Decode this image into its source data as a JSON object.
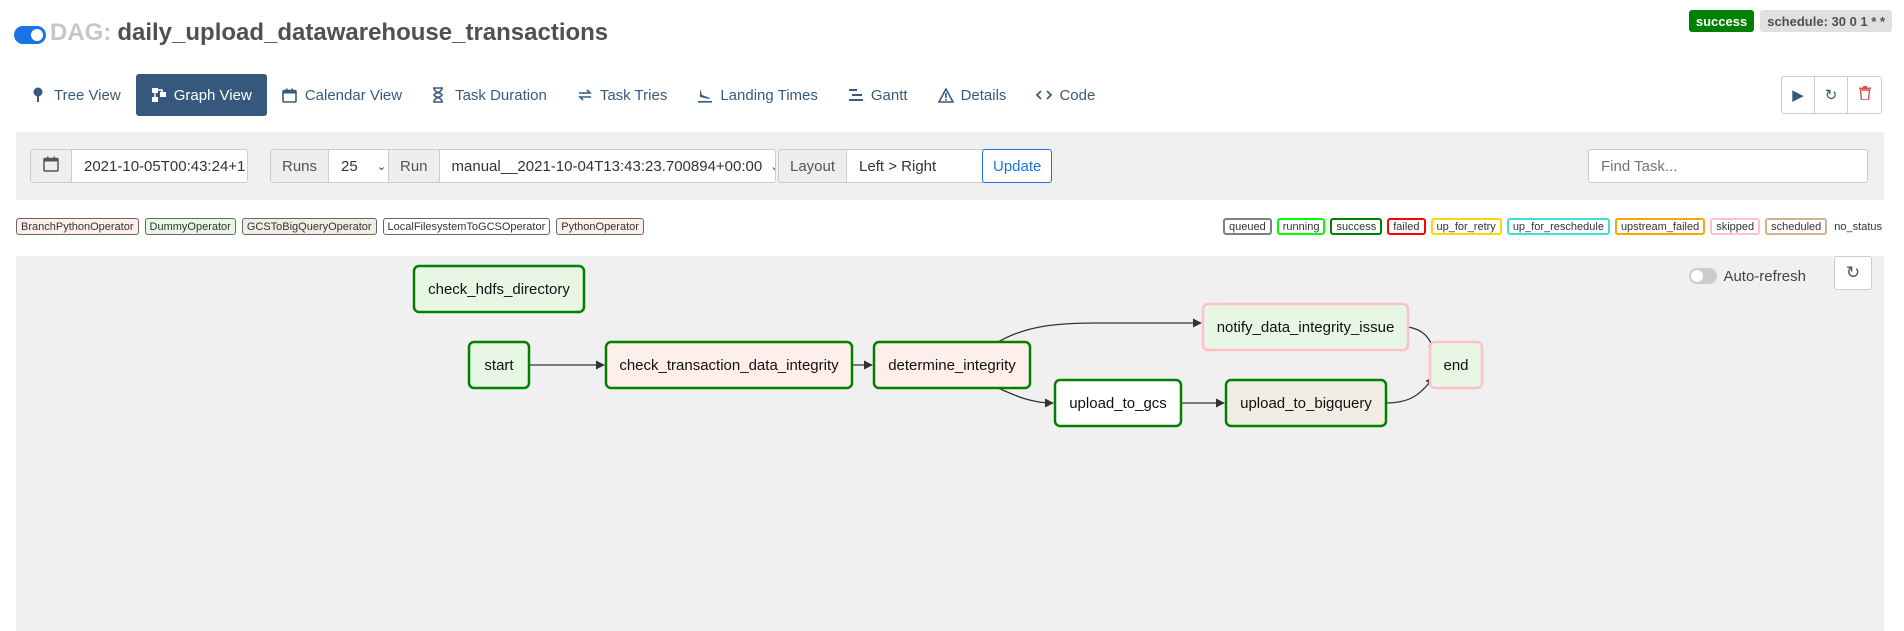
{
  "header": {
    "dag_label": "DAG:",
    "dag_id": "daily_upload_datawarehouse_transactions",
    "toggle_icon": "toggle-on-icon",
    "state_badge": "success",
    "schedule_badge": "schedule: 30 0 1 * *"
  },
  "nav": {
    "tabs": [
      {
        "label": "Tree View",
        "icon": "tree-icon"
      },
      {
        "label": "Graph View",
        "icon": "graph-icon",
        "active": true
      },
      {
        "label": "Calendar View",
        "icon": "calendar-icon"
      },
      {
        "label": "Task Duration",
        "icon": "hourglass-icon"
      },
      {
        "label": "Task Tries",
        "icon": "retry-icon"
      },
      {
        "label": "Landing Times",
        "icon": "plane-landing-icon"
      },
      {
        "label": "Gantt",
        "icon": "gantt-icon"
      },
      {
        "label": "Details",
        "icon": "warning-triangle-icon"
      },
      {
        "label": "Code",
        "icon": "code-icon"
      }
    ],
    "tools": [
      {
        "icon": "play-icon"
      },
      {
        "icon": "refresh-icon"
      },
      {
        "icon": "trash-icon"
      }
    ]
  },
  "filters": {
    "date_icon": "calendar-icon",
    "base_date": "2021-10-05T00:43:24+1",
    "runs_label": "Runs",
    "runs_value": "25",
    "run_label": "Run",
    "run_value": "manual__2021-10-04T13:43:23.700894+00:00",
    "layout_label": "Layout",
    "layout_value": "Left > Right",
    "update_label": "Update",
    "find_placeholder": "Find Task..."
  },
  "legend": {
    "operators": [
      {
        "label": "BranchPythonOperator",
        "color": "#ffefeb"
      },
      {
        "label": "DummyOperator",
        "color": "#e8f7e4"
      },
      {
        "label": "GCSToBigQueryOperator",
        "color": "#f0eee4"
      },
      {
        "label": "LocalFilesystemToGCSOperator",
        "color": "#ffffff"
      },
      {
        "label": "PythonOperator",
        "color": "#ffefeb"
      }
    ],
    "states": [
      {
        "label": "queued",
        "color": "#808080"
      },
      {
        "label": "running",
        "color": "#00ff00"
      },
      {
        "label": "success",
        "color": "#008000"
      },
      {
        "label": "failed",
        "color": "#ff0000"
      },
      {
        "label": "up_for_retry",
        "color": "#ffd700"
      },
      {
        "label": "up_for_reschedule",
        "color": "#40e0d0"
      },
      {
        "label": "upstream_failed",
        "color": "#ffa500"
      },
      {
        "label": "skipped",
        "color": "#ffc0cb"
      },
      {
        "label": "scheduled",
        "color": "#d2b48c"
      },
      {
        "label": "no_status",
        "color": ""
      }
    ]
  },
  "graph": {
    "auto_refresh_label": "Auto-refresh",
    "refresh_icon": "refresh-icon",
    "nodes": [
      {
        "id": "check_hdfs_directory",
        "label": "check_hdfs_directory",
        "state": "success",
        "fill": "#e8f7e4",
        "stroke": "#008000"
      },
      {
        "id": "start",
        "label": "start",
        "state": "success",
        "fill": "#e8f7e4",
        "stroke": "#008000"
      },
      {
        "id": "check_transaction_data_integrity",
        "label": "check_transaction_data_integrity",
        "state": "success",
        "fill": "#ffefeb",
        "stroke": "#008000"
      },
      {
        "id": "determine_integrity",
        "label": "determine_integrity",
        "state": "success",
        "fill": "#ffefeb",
        "stroke": "#008000"
      },
      {
        "id": "notify_data_integrity_issue",
        "label": "notify_data_integrity_issue",
        "state": "skipped",
        "fill": "#e8f7e4",
        "stroke": "#ffc0cb"
      },
      {
        "id": "upload_to_gcs",
        "label": "upload_to_gcs",
        "state": "success",
        "fill": "#ffffff",
        "stroke": "#008000"
      },
      {
        "id": "upload_to_bigquery",
        "label": "upload_to_bigquery",
        "state": "success",
        "fill": "#f0eee4",
        "stroke": "#008000"
      },
      {
        "id": "end",
        "label": "end",
        "state": "skipped",
        "fill": "#e8f7e4",
        "stroke": "#ffc0cb"
      }
    ],
    "edges": [
      {
        "from": "start",
        "to": "check_transaction_data_integrity"
      },
      {
        "from": "check_transaction_data_integrity",
        "to": "determine_integrity"
      },
      {
        "from": "determine_integrity",
        "to": "notify_data_integrity_issue"
      },
      {
        "from": "determine_integrity",
        "to": "upload_to_gcs"
      },
      {
        "from": "upload_to_gcs",
        "to": "upload_to_bigquery"
      },
      {
        "from": "notify_data_integrity_issue",
        "to": "end"
      },
      {
        "from": "upload_to_bigquery",
        "to": "end"
      }
    ]
  }
}
